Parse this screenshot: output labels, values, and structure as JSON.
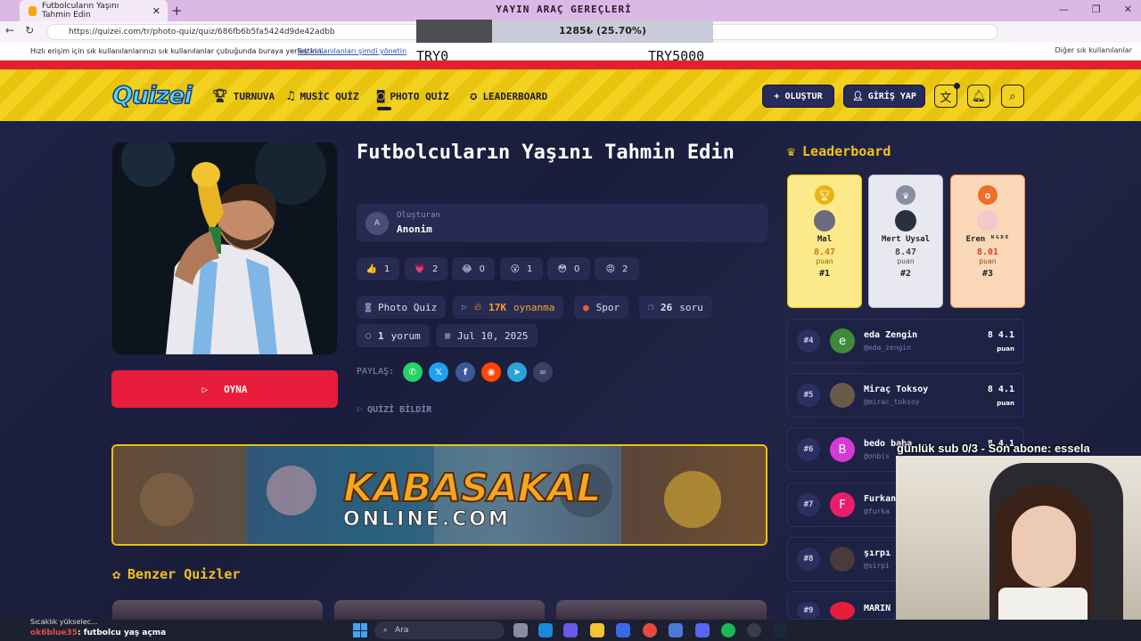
{
  "browser": {
    "tab_title": "Futbolcuların Yaşını Tahmin Edin",
    "url": "https://quizei.com/tr/photo-quiz/quiz/686fb6b5fa5424d9de42adbb",
    "bookmarks_hint": "Hızlı erişim için sık kullanılanlarınızı sık kullanılanlar çubuğunda buraya yerleştirin.",
    "bookmarks_link": "Sık kullanılanları şimdi yönetin",
    "bookmarks_other": "Diğer sık kullanılanlar"
  },
  "overlay": {
    "title": "YAYIN ARAÇ GEREÇLERİ",
    "progress_text": "1285₺ (25.70%)",
    "progress": 0.257,
    "left_label": "TRY0",
    "right_label": "TRY5000",
    "sub_text": "günlük sub 0/3 - Son abone: essela"
  },
  "header": {
    "logo": "Quizei",
    "nav": [
      {
        "label": "TURNUVA",
        "icon": "trophy-icon"
      },
      {
        "label": "MUSİC QUİZ",
        "icon": "music-icon"
      },
      {
        "label": "PHOTO QUİZ",
        "icon": "camera-icon"
      },
      {
        "label": "LEADERBOARD",
        "icon": "award-icon"
      }
    ],
    "create_label": "+ OLUŞTUR",
    "login_label": "GİRİŞ YAP"
  },
  "quiz": {
    "title": "Futbolcuların Yaşını Tahmin Edin",
    "creator_label": "Oluşturan",
    "creator_name": "Anonim",
    "creator_initial": "A",
    "play_label": "OYNA",
    "reactions": [
      {
        "emoji": "👍",
        "count": "1"
      },
      {
        "emoji": "💗",
        "count": "2"
      },
      {
        "emoji": "😂",
        "count": "0"
      },
      {
        "emoji": "😮",
        "count": "1"
      },
      {
        "emoji": "😳",
        "count": "0"
      },
      {
        "emoji": "😡",
        "count": "2"
      }
    ],
    "chips": {
      "type": "Photo Quiz",
      "plays_value": "17K",
      "plays_label": "oynanma",
      "category": "Spor",
      "questions_value": "26",
      "questions_label": "soru",
      "comments_value": "1",
      "comments_label": "yorum",
      "date": "Jul 10, 2025"
    },
    "share_label": "PAYLAŞ:",
    "report_label": "QUİZİ BİLDİR"
  },
  "banner": {
    "text": "KABASAKAL",
    "subtext": "ONLINE.COM"
  },
  "similar": {
    "title": "Benzer Quizler"
  },
  "leaderboard": {
    "title": "Leaderboard",
    "podium": [
      {
        "name": "Mal",
        "score": "8.47",
        "label": "puan",
        "rank": "#1"
      },
      {
        "name": "Mert Uysal",
        "score": "8.47",
        "label": "puan",
        "rank": "#2"
      },
      {
        "name": "Eren ᴺᴳᴰᴱ",
        "score": "8.01",
        "label": "puan",
        "rank": "#3"
      }
    ],
    "rows": [
      {
        "rank": "#4",
        "initial": "e",
        "name": "eda Zengin",
        "user": "@eda_zengin",
        "score": "8 4.1",
        "label": "puan",
        "color": "#3f8a3a"
      },
      {
        "rank": "#5",
        "initial": "",
        "name": "Miraç Toksoy",
        "user": "@mirac_toksoy",
        "score": "8 4.1",
        "label": "puan",
        "color": "#6a5a4a"
      },
      {
        "rank": "#6",
        "initial": "B",
        "name": "bedo baba",
        "user": "@onbis",
        "score": "8 4.1",
        "label": "",
        "color": "#d63ad6"
      },
      {
        "rank": "#7",
        "initial": "F",
        "name": "Furkan",
        "user": "@furka",
        "score": "",
        "label": "",
        "color": "#e81d6b"
      },
      {
        "rank": "#8",
        "initial": "",
        "name": "şırpı",
        "user": "@sirpi",
        "score": "",
        "label": "",
        "color": "#4a3a3a"
      },
      {
        "rank": "#9",
        "initial": "",
        "name": "MARIN",
        "user": "",
        "score": "",
        "label": "",
        "color": "#e81d3b"
      }
    ]
  },
  "taskbar": {
    "weather": "Sıcaklık yükselec...",
    "chat_user": "ok6blue35",
    "chat_msg": ": futbolcu yaş açma",
    "search": "Ara"
  }
}
